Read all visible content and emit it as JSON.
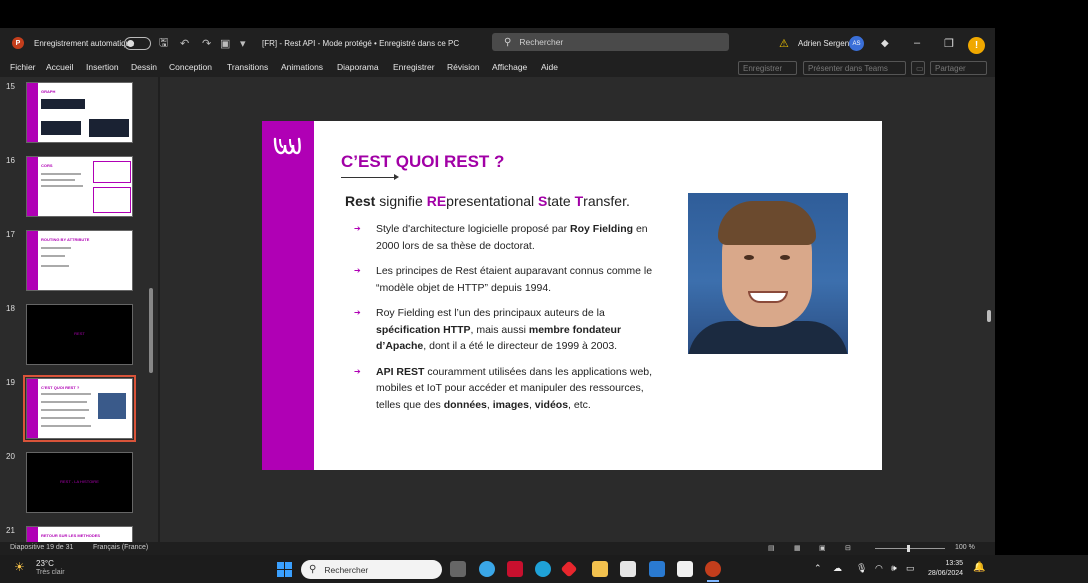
{
  "titlebar": {
    "app_icon": "P",
    "autosave_label": "Enregistrement automatique",
    "doc_title": "[FR] - Rest API  -  Mode protégé  •  Enregistré dans ce PC",
    "search_placeholder": "Rechercher",
    "user_name": "Adrien Sergent",
    "user_initials": "AS"
  },
  "menu": {
    "items": [
      "Fichier",
      "Accueil",
      "Insertion",
      "Dessin",
      "Conception",
      "Transitions",
      "Animations",
      "Diaporama",
      "Enregistrer",
      "Révision",
      "Affichage",
      "Aide"
    ],
    "record_button": "Enregistrer",
    "present_teams_button": "Présenter dans Teams",
    "share_button": "Partager"
  },
  "thumbnails": [
    {
      "num": "15",
      "title": "GRAPH"
    },
    {
      "num": "16",
      "title": "CORS"
    },
    {
      "num": "17",
      "title": "ROUTING BY ATTRIBUTE"
    },
    {
      "num": "18",
      "title": "REST"
    },
    {
      "num": "19",
      "title": "C'EST QUOI REST ?"
    },
    {
      "num": "20",
      "title": "REST - LA HISTOIRE"
    },
    {
      "num": "21",
      "title": "RETOUR SUR LES METHODES"
    }
  ],
  "slide": {
    "title": "C’EST QUOI REST ?",
    "subtitle": {
      "p1": "Rest",
      "p2": " signifie ",
      "p3": "RE",
      "p4": "presentational ",
      "p5": "S",
      "p6": "tate ",
      "p7": "T",
      "p8": "ransfer."
    },
    "bullets": [
      {
        "a": "Style d'architecture logicielle proposé par ",
        "b": "Roy Fielding",
        "c": " en 2000 lors de sa thèse de doctorat."
      },
      {
        "a": "Les principes de Rest étaient auparavant connus comme le “modèle objet de HTTP” depuis 1994.",
        "b": "",
        "c": ""
      },
      {
        "a": "Roy Fielding est l’un des principaux auteurs de la ",
        "b": "spécification HTTP",
        "c": ", mais aussi ",
        "d": "membre fondateur d’Apache",
        "e": ", dont il a été le directeur de 1999 à 2003."
      },
      {
        "a": "",
        "b": "API REST",
        "c": " couramment utilisées dans les applications web, mobiles et IoT pour accéder et manipuler des ressources, telles que des ",
        "d": "données",
        "e": ", ",
        "f": "images",
        "g": ", ",
        "h": "vidéos",
        "i": ", etc."
      }
    ]
  },
  "status": {
    "slide_position": "Diapositive 19 de 31",
    "language": "Français (France)",
    "zoom": "100 %"
  },
  "taskbar": {
    "weather_temp": "23°C",
    "weather_desc": "Très clair",
    "search_label": "Rechercher",
    "time": "13:35",
    "date": "28/06/2024"
  },
  "colors": {
    "accent": "#b000b5",
    "title_magenta": "#a100a6"
  }
}
